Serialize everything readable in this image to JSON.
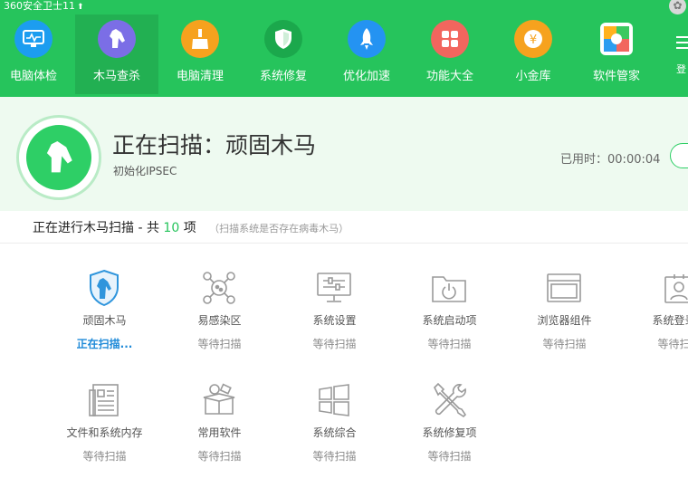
{
  "app": {
    "title": "360安全卫士11"
  },
  "colors": {
    "brand_green": "#26c45c",
    "active_blue": "#1f8ad8"
  },
  "nav": [
    {
      "label": "电脑体检",
      "icon": "monitor-check-icon",
      "color": "#1c9df0",
      "active": false
    },
    {
      "label": "木马查杀",
      "icon": "horse-icon",
      "color": "#7b6ee6",
      "active": true
    },
    {
      "label": "电脑清理",
      "icon": "broom-icon",
      "color": "#f6a21e",
      "active": false
    },
    {
      "label": "系统修复",
      "icon": "shield-icon",
      "color": "#1ba84c",
      "active": false
    },
    {
      "label": "优化加速",
      "icon": "rocket-icon",
      "color": "#2493f2",
      "active": false
    },
    {
      "label": "功能大全",
      "icon": "grid-icon",
      "color": "#f2665e",
      "active": false
    },
    {
      "label": "小金库",
      "icon": "coin-icon",
      "color": "#f6a21e",
      "active": false
    },
    {
      "label": "软件管家",
      "icon": "software-manager-icon",
      "color": "#ffffff",
      "active": false
    },
    {
      "label": "登",
      "icon": "menu-icon",
      "color": "#26c45c",
      "active": false
    }
  ],
  "scan": {
    "title": "正在扫描：顽固木马",
    "subtitle": "初始化IPSEC",
    "elapsed_label": "已用时：",
    "elapsed_value": "00:00:04"
  },
  "summary": {
    "prefix": "正在进行木马扫描 - 共",
    "count": "10",
    "suffix": "项",
    "note": "（扫描系统是否存在病毒木马）"
  },
  "items": [
    {
      "name": "顽固木马",
      "status": "正在扫描...",
      "icon": "shield-horse-icon",
      "active": true
    },
    {
      "name": "易感染区",
      "status": "等待扫描",
      "icon": "virus-icon",
      "active": false
    },
    {
      "name": "系统设置",
      "status": "等待扫描",
      "icon": "settings-monitor-icon",
      "active": false
    },
    {
      "name": "系统启动项",
      "status": "等待扫描",
      "icon": "startup-folder-icon",
      "active": false
    },
    {
      "name": "浏览器组件",
      "status": "等待扫描",
      "icon": "browser-window-icon",
      "active": false
    },
    {
      "name": "系统登录相",
      "status": "等待扫描",
      "icon": "user-login-icon",
      "active": false
    },
    {
      "name": "文件和系统内存",
      "status": "等待扫描",
      "icon": "document-icon",
      "active": false
    },
    {
      "name": "常用软件",
      "status": "等待扫描",
      "icon": "software-box-icon",
      "active": false
    },
    {
      "name": "系统综合",
      "status": "等待扫描",
      "icon": "windows-icon",
      "active": false
    },
    {
      "name": "系统修复项",
      "status": "等待扫描",
      "icon": "tools-icon",
      "active": false
    }
  ]
}
